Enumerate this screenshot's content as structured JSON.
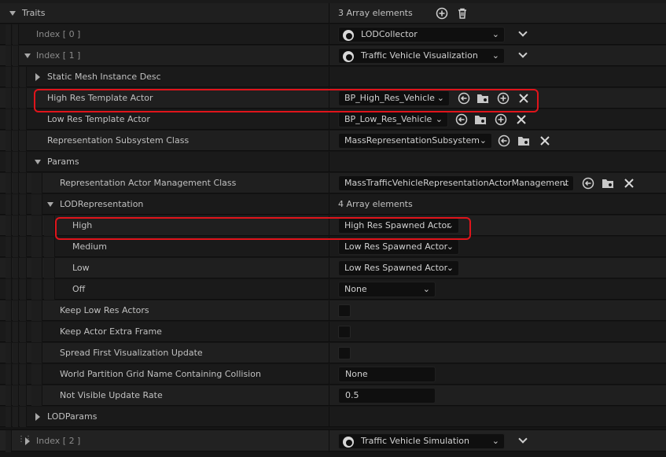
{
  "traits": {
    "label": "Traits",
    "count": "3 Array elements"
  },
  "index0": {
    "label": "Index [ 0 ]",
    "value": "LODCollector"
  },
  "index1": {
    "label": "Index [ 1 ]",
    "value": "Traffic Vehicle Visualization"
  },
  "static_mesh": {
    "label": "Static Mesh Instance Desc"
  },
  "high_res": {
    "label": "High Res Template Actor",
    "value": "BP_High_Res_Vehicle"
  },
  "low_res": {
    "label": "Low Res Template Actor",
    "value": "BP_Low_Res_Vehicle"
  },
  "rep_subsystem": {
    "label": "Representation Subsystem Class",
    "value": "MassRepresentationSubsystem"
  },
  "params": {
    "label": "Params"
  },
  "rep_actor_mgmt": {
    "label": "Representation Actor Management Class",
    "value": "MassTrafficVehicleRepresentationActorManagement"
  },
  "lod_rep": {
    "label": "LODRepresentation",
    "count": "4 Array elements"
  },
  "lod_high": {
    "label": "High",
    "value": "High Res Spawned Actor"
  },
  "lod_medium": {
    "label": "Medium",
    "value": "Low Res Spawned Actor"
  },
  "lod_low": {
    "label": "Low",
    "value": "Low Res Spawned Actor"
  },
  "lod_off": {
    "label": "Off",
    "value": "None"
  },
  "keep_low_res": {
    "label": "Keep Low Res Actors",
    "checked": false
  },
  "keep_extra_frame": {
    "label": "Keep Actor Extra Frame",
    "checked": false
  },
  "spread_first": {
    "label": "Spread First Visualization Update",
    "checked": false
  },
  "wp_grid": {
    "label": "World Partition Grid Name Containing Collision",
    "value": "None"
  },
  "not_visible_rate": {
    "label": "Not Visible Update Rate",
    "value": "0.5"
  },
  "lod_params": {
    "label": "LODParams"
  },
  "index2": {
    "label": "Index [ 2 ]",
    "value": "Traffic Vehicle Simulation"
  },
  "colors": {
    "background": "#151515",
    "highlight": "#e0141b",
    "text": "#c0c0c0"
  }
}
